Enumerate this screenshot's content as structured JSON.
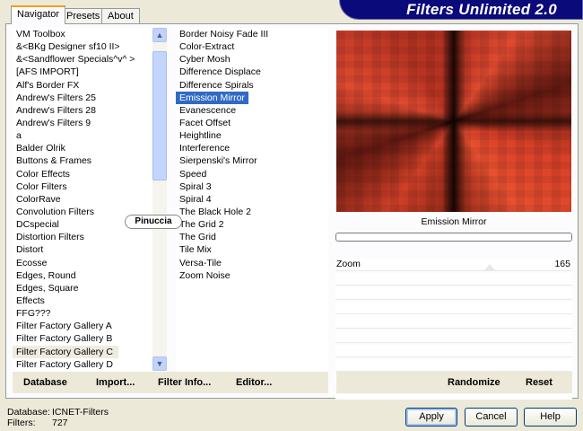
{
  "title": "Filters Unlimited 2.0",
  "tabs": [
    "Navigator",
    "Presets",
    "About"
  ],
  "categories": [
    "VM Toolbox",
    "&<BKg Designer sf10 II>",
    "&<Sandflower Specials^v^ >",
    "[AFS IMPORT]",
    "Alf's Border FX",
    "Andrew's Filters 25",
    "Andrew's Filters 28",
    "Andrew's Filters 9",
    "a",
    "Balder Olrik",
    "Buttons & Frames",
    "Color Effects",
    "Color Filters",
    "ColorRave",
    "Convolution Filters",
    "DCspecial",
    "Distortion Filters",
    "Distort",
    "Ecosse",
    "Edges, Round",
    "Edges, Square",
    "Effects",
    "FFG???",
    "Filter Factory Gallery A",
    "Filter Factory Gallery B",
    "Filter Factory Gallery C",
    "Filter Factory Gallery D"
  ],
  "selected_category": "Filter Factory Gallery C",
  "filters": [
    "Border Noisy Fade III",
    "Color-Extract",
    "Cyber Mosh",
    "Difference Displace",
    "Difference Spirals",
    "Emission Mirror",
    "Evanescence",
    "Facet Offset",
    "Heightline",
    "Interference",
    "Sierpenski's Mirror",
    "Speed",
    "Spiral 3",
    "Spiral 4",
    "The Black Hole 2",
    "The Grid 2",
    "The Grid",
    "Tile Mix",
    "Versa-Tile",
    "Zoom Noise"
  ],
  "selected_filter": "Emission Mirror",
  "preview_label": "Emission Mirror",
  "params": [
    {
      "label": "Zoom",
      "value": "165",
      "fraction": 0.65
    }
  ],
  "buttons": {
    "database": "Database",
    "import": "Import...",
    "filter_info": "Filter Info...",
    "editor": "Editor...",
    "randomize": "Randomize",
    "reset": "Reset",
    "apply": "Apply",
    "cancel": "Cancel",
    "help": "Help"
  },
  "status": {
    "database_label": "Database:",
    "database_value": "ICNET-Filters",
    "filters_label": "Filters:",
    "filters_value": "727"
  },
  "watermark": "Pinuccia"
}
